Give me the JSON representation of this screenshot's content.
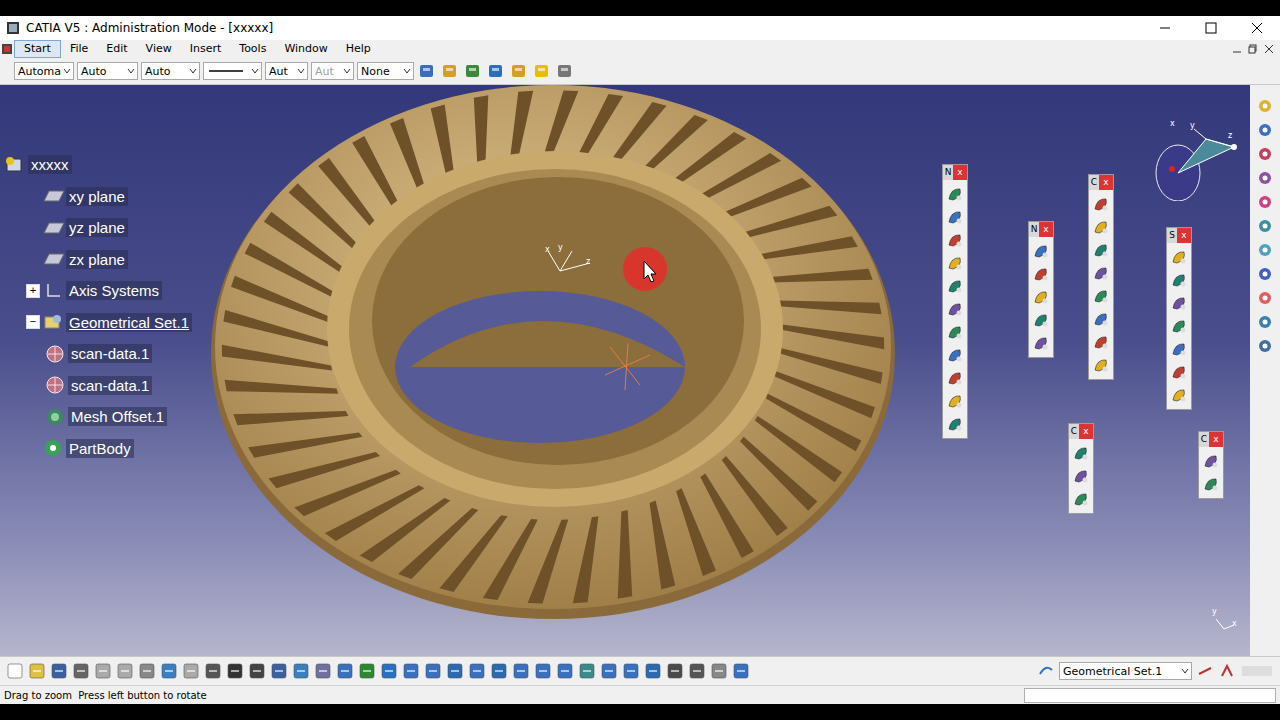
{
  "window": {
    "title": "CATIA V5 : Administration Mode - [xxxxx]"
  },
  "menu": [
    {
      "label": "Start",
      "selected": true
    },
    {
      "label": "File",
      "selected": false
    },
    {
      "label": "Edit",
      "selected": false
    },
    {
      "label": "View",
      "selected": false
    },
    {
      "label": "Insert",
      "selected": false
    },
    {
      "label": "Tools",
      "selected": false
    },
    {
      "label": "Window",
      "selected": false
    },
    {
      "label": "Help",
      "selected": false
    }
  ],
  "toolbar_dropdowns": [
    {
      "value": "Automa",
      "kind": "text",
      "disabled": false
    },
    {
      "value": "Auto",
      "kind": "text",
      "disabled": false
    },
    {
      "value": "Auto",
      "kind": "text",
      "disabled": false
    },
    {
      "value": "",
      "kind": "line",
      "disabled": false
    },
    {
      "value": "Aut",
      "kind": "text",
      "disabled": false
    },
    {
      "value": "Aut",
      "kind": "text",
      "disabled": true
    },
    {
      "value": "None",
      "kind": "text",
      "disabled": false
    }
  ],
  "tree": [
    {
      "label": "xxxxx",
      "depth": 0,
      "kind": "part",
      "expander": "",
      "active": false
    },
    {
      "label": "xy plane",
      "depth": 1,
      "kind": "plane",
      "expander": "",
      "active": false
    },
    {
      "label": "yz plane",
      "depth": 1,
      "kind": "plane",
      "expander": "",
      "active": false
    },
    {
      "label": "zx plane",
      "depth": 1,
      "kind": "plane",
      "expander": "",
      "active": false
    },
    {
      "label": "Axis Systems",
      "depth": 1,
      "kind": "axis",
      "expander": "+",
      "active": false
    },
    {
      "label": "Geometrical Set.1",
      "depth": 1,
      "kind": "set",
      "expander": "−",
      "active": true
    },
    {
      "label": "scan-data.1",
      "depth": 2,
      "kind": "mesh",
      "expander": "",
      "active": false
    },
    {
      "label": "scan-data.1",
      "depth": 2,
      "kind": "mesh",
      "expander": "",
      "active": false
    },
    {
      "label": "Mesh Offset.1",
      "depth": 2,
      "kind": "offset",
      "expander": "",
      "active": false
    },
    {
      "label": "PartBody",
      "depth": 1,
      "kind": "body",
      "expander": "",
      "active": false
    }
  ],
  "floating_toolbars": [
    {
      "title": "N",
      "close": "x"
    },
    {
      "title": "N",
      "close": "x"
    },
    {
      "title": "C",
      "close": "x"
    },
    {
      "title": "S",
      "close": "x"
    },
    {
      "title": "C",
      "close": "x"
    },
    {
      "title": "C",
      "close": "x"
    }
  ],
  "compass": {
    "labels": [
      "x",
      "y",
      "z"
    ]
  },
  "model_axis": {
    "labels": [
      "x",
      "y",
      "z"
    ]
  },
  "corner_axis": {
    "labels": [
      "y",
      "x"
    ]
  },
  "bottom_toolbar": {
    "current_set": "Geometrical Set.1"
  },
  "status_bar": {
    "message": "Drag to zoom  Press left button to rotate"
  }
}
